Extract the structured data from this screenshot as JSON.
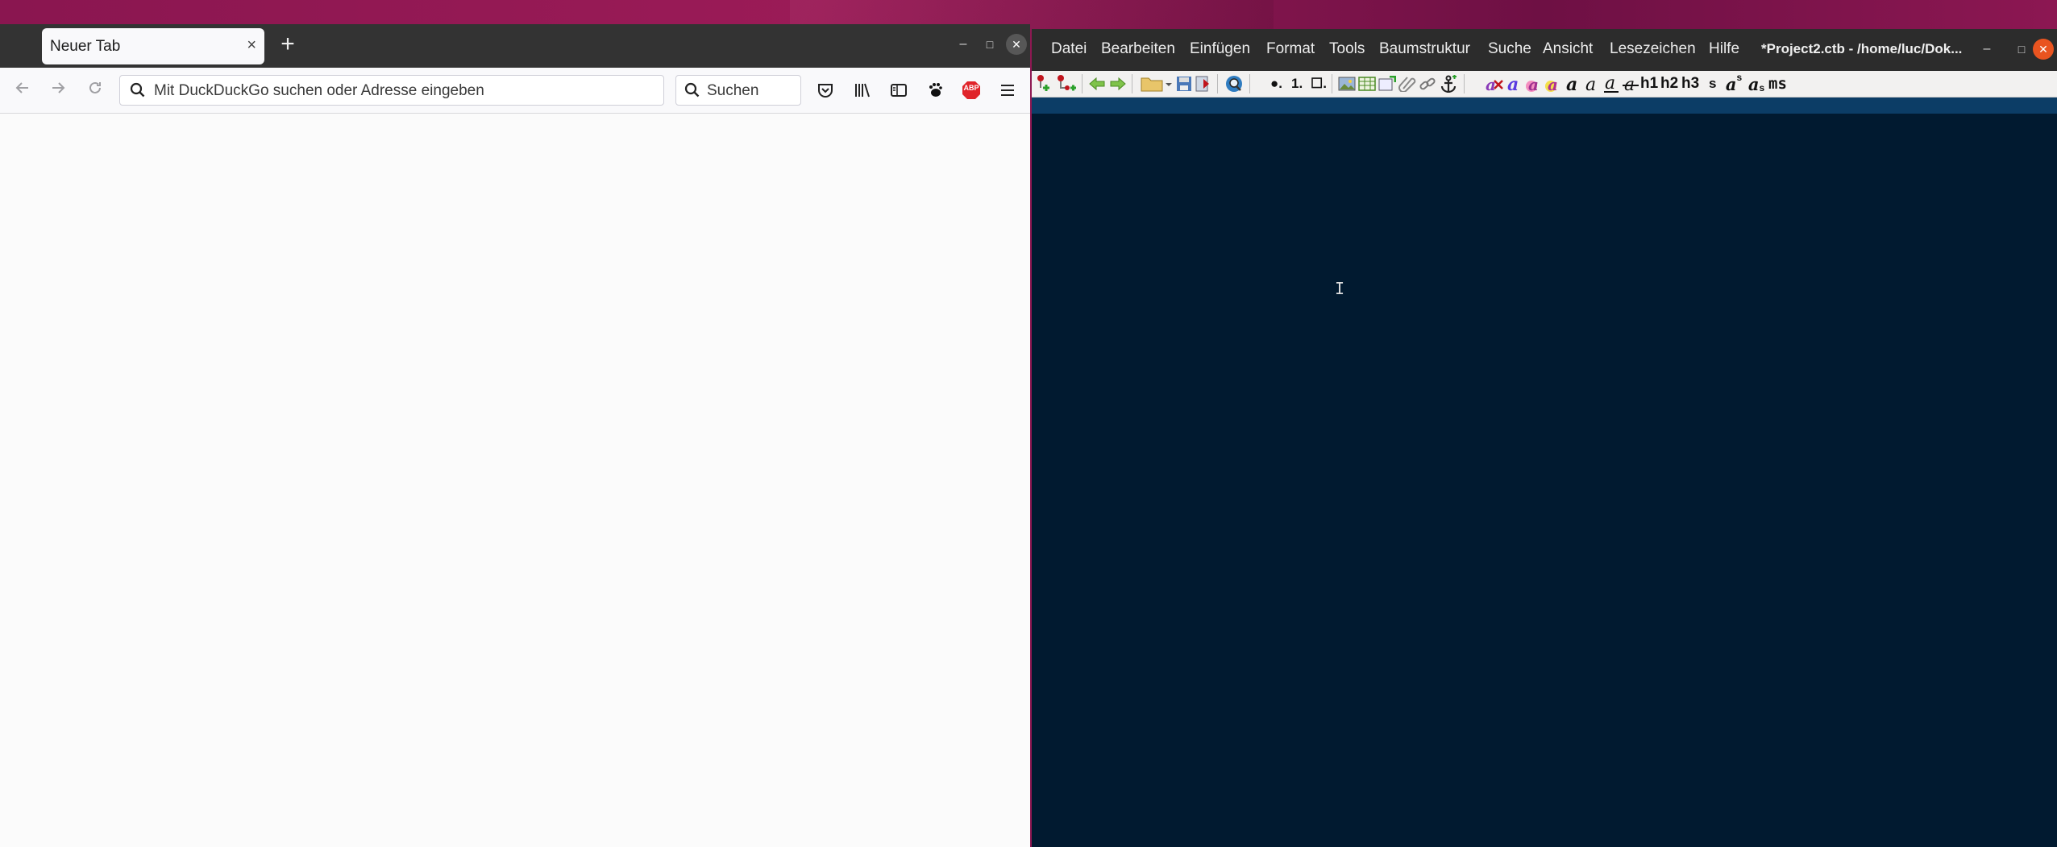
{
  "firefox": {
    "tab_title": "Neuer Tab",
    "tab_close": "×",
    "new_tab": "+",
    "window_buttons": {
      "minimize": "–",
      "maximize": "□",
      "close": "✕"
    },
    "urlbar_placeholder": "Mit DuckDuckGo suchen oder Adresse eingeben",
    "search_placeholder": "Suchen",
    "abp_label": "ABP"
  },
  "cherrytree": {
    "menu": [
      "Datei",
      "Bearbeiten",
      "Einfügen",
      "Format",
      "Tools",
      "Baumstruktur",
      "Suche",
      "Ansicht",
      "Lesezeichen",
      "Hilfe"
    ],
    "title": "*Project2.ctb - /home/luc/Dok...",
    "window_buttons": {
      "minimize": "–",
      "maximize": "□",
      "close": "✕"
    },
    "toolbar_text": {
      "bullet_list": "●.",
      "numbered_list": "1.",
      "todo_list": "☐.",
      "h1": "h1",
      "h2": "h2",
      "h3": "h3",
      "small": "s",
      "superscript_a": "a",
      "superscript_s": "s",
      "subscript_a": "a",
      "subscript_s": "s",
      "monospace": "ms"
    },
    "cursor": "I"
  },
  "colors": {
    "desktop": "#8a1650",
    "firefox_tabbar": "#333333",
    "cherrytree_editor": "#011a30",
    "cherrytree_selection": "#0c3d66",
    "accent_orange": "#e95420"
  }
}
